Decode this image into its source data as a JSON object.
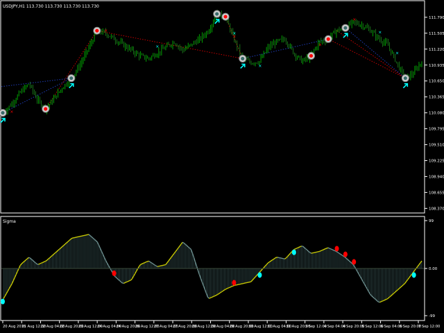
{
  "window": {
    "symbol_line": "USDJPY,H1  113.730 113.730 113.730 113.730"
  },
  "colors": {
    "background": "#000000",
    "frame": "#ffffff",
    "candle_up": "#00c800",
    "candle_down": "#1e8c1e",
    "osc_pos": "#c8c800",
    "osc_neg": "#6a8c8c",
    "osc_hist": "#3c5a5a",
    "red_line": "#c80000",
    "blue_line": "#1e3cb4",
    "arrow_cyan": "#00ffff",
    "signal_red": "#ff0000",
    "text": "#ffffff"
  },
  "panels": {
    "price": {
      "y_ticks": [
        "111.790",
        "111.505",
        "111.220",
        "110.935",
        "110.650",
        "110.365",
        "110.080",
        "109.795",
        "109.510",
        "109.225",
        "108.940",
        "108.655",
        "108.370"
      ]
    },
    "oscillator": {
      "title": "Sigma",
      "y_ticks": [
        "99",
        "0.00",
        "-99"
      ]
    }
  },
  "x_axis": {
    "labels": [
      "20 Aug 2018",
      "21 Aug 12:00",
      "22 Aug 04:00",
      "22 Aug 20:00",
      "23 Aug 12:00",
      "24 Aug 04:00",
      "24 Aug 20:00",
      "26 Aug 12:00",
      "27 Aug 04:00",
      "27 Aug 20:00",
      "28 Aug 12:00",
      "29 Aug 04:00",
      "29 Aug 20:00",
      "30 Aug 12:00",
      "31 Aug 04:00",
      "31 Aug 20:00",
      "3 Sep 12:00",
      "4 Sep 04:00",
      "4 Sep 20:00",
      "5 Sep 12:00",
      "6 Sep 04:00",
      "6 Sep 20:00",
      "7 Sep 12:00"
    ]
  },
  "chart_data": {
    "type": "candlestick",
    "instrument": "USDJPY",
    "timeframe": "H1",
    "close_path": [
      110.08,
      110.25,
      110.45,
      110.6,
      110.3,
      110.15,
      110.35,
      110.55,
      110.7,
      110.95,
      111.25,
      111.55,
      111.5,
      111.4,
      111.3,
      111.2,
      111.1,
      111.05,
      111.15,
      111.25,
      111.35,
      111.2,
      111.3,
      111.4,
      111.55,
      111.85,
      111.8,
      111.4,
      111.05,
      110.98,
      111.0,
      111.25,
      111.35,
      111.4,
      111.15,
      111.0,
      111.1,
      111.35,
      111.4,
      111.55,
      111.6,
      111.7,
      111.65,
      111.55,
      111.4,
      111.3,
      111.0,
      110.7,
      110.78,
      111.0
    ],
    "oscillator_path": [
      -80,
      -40,
      10,
      30,
      10,
      20,
      40,
      60,
      80,
      85,
      90,
      70,
      20,
      -20,
      -40,
      -30,
      10,
      20,
      5,
      10,
      40,
      70,
      50,
      -20,
      -80,
      -70,
      -55,
      -45,
      -40,
      -35,
      -10,
      15,
      30,
      25,
      50,
      60,
      40,
      45,
      55,
      45,
      30,
      10,
      -30,
      -70,
      -90,
      -80,
      -60,
      -40,
      -10,
      20
    ],
    "signals": {
      "sell_circles": [
        5,
        11,
        26,
        36,
        38
      ],
      "buy_circles": [
        0,
        8,
        25,
        28,
        40,
        47
      ],
      "sell_markers_osc": [
        13,
        27,
        39,
        40,
        41
      ],
      "buy_markers_osc": [
        0,
        30,
        34,
        48
      ]
    }
  }
}
